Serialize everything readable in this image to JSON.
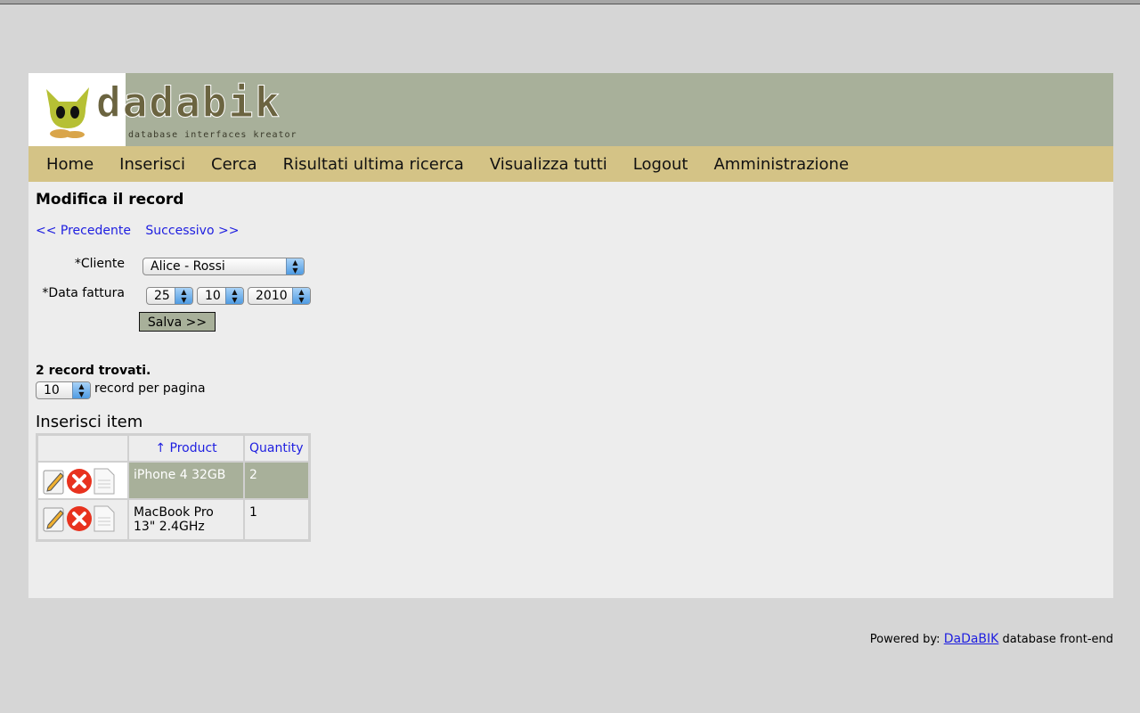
{
  "brand": {
    "name": "dadabik",
    "tagline": "database interfaces kreator"
  },
  "nav": {
    "items": [
      {
        "label": "Home"
      },
      {
        "label": "Inserisci"
      },
      {
        "label": "Cerca"
      },
      {
        "label": "Risultati ultima ricerca"
      },
      {
        "label": "Visualizza tutti"
      },
      {
        "label": "Logout"
      },
      {
        "label": "Amministrazione"
      }
    ]
  },
  "main": {
    "title": "Modifica il record",
    "prev_label": "<< Precedente",
    "next_label": "Successivo >>",
    "form": {
      "cliente_label": "*Cliente",
      "cliente_value": "Alice - Rossi",
      "data_label": "*Data fattura",
      "day": "25",
      "month": "10",
      "year": "2010",
      "save_label": "Salva >>"
    },
    "results": {
      "found": "2 record trovati.",
      "per_page_value": "10",
      "per_page_label": "record per pagina"
    },
    "items": {
      "title": "Inserisci item",
      "columns": [
        "↑ Product",
        "Quantity"
      ],
      "rows": [
        {
          "product": "iPhone 4 32GB",
          "quantity": "2"
        },
        {
          "product": "MacBook Pro 13\" 2.4GHz",
          "quantity": "1"
        }
      ]
    }
  },
  "footer": {
    "prefix": "Powered by:",
    "link": "DaDaBIK",
    "suffix": "database front-end"
  },
  "colors": {
    "header_bg": "#a8b09a",
    "nav_bg": "#d4c386",
    "link": "#1e1ee0",
    "highlight_row": "#a8b09a"
  }
}
